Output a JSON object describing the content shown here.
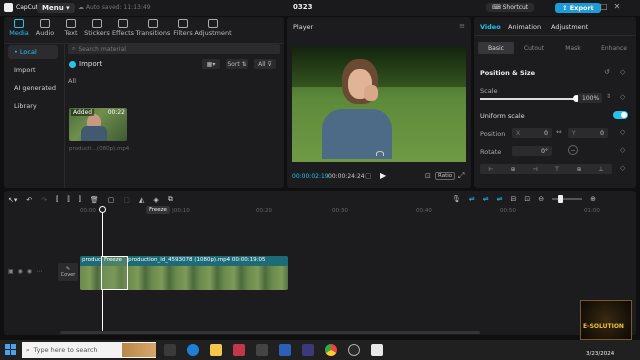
{
  "titlebar": {
    "app_name": "CapCut",
    "menu_label": "Menu",
    "autosave": "Auto saved: 11:13:49",
    "project_name": "0323",
    "shortcut_label": "Shortcut",
    "export_label": "Export"
  },
  "toolbar": {
    "tabs": [
      {
        "label": "Media",
        "icon": "media-icon"
      },
      {
        "label": "Audio",
        "icon": "audio-icon"
      },
      {
        "label": "Text",
        "icon": "text-icon"
      },
      {
        "label": "Stickers",
        "icon": "stickers-icon"
      },
      {
        "label": "Effects",
        "icon": "effects-icon"
      },
      {
        "label": "Transitions",
        "icon": "transitions-icon"
      },
      {
        "label": "Filters",
        "icon": "filters-icon"
      },
      {
        "label": "Adjustment",
        "icon": "adjustment-icon"
      }
    ]
  },
  "media": {
    "sidebar": [
      "• Local",
      "Import",
      "AI generated",
      "Library"
    ],
    "search_placeholder": "Search material",
    "import_label": "Import",
    "sort_label": "Sort",
    "all_label": "All",
    "filter_all": "All",
    "clip": {
      "badge": "Added",
      "duration": "00:22",
      "name": "producti...(080p).mp4"
    }
  },
  "player": {
    "title": "Player",
    "current_time": "00:00:02:19",
    "total_time": "00:00:24:24",
    "ratio_label": "Ratio"
  },
  "props": {
    "tabs": [
      "Video",
      "Animation",
      "Adjustment"
    ],
    "subtabs": [
      "Basic",
      "Cutout",
      "Mask",
      "Enhance"
    ],
    "section_title": "Position & Size",
    "scale_label": "Scale",
    "scale_value": "100%",
    "scale_level": 1.0,
    "uniform_label": "Uniform scale",
    "position_label": "Position",
    "pos_x_label": "X",
    "pos_x": "0",
    "pos_y_label": "Y",
    "pos_y": "0",
    "rotate_label": "Rotate",
    "rotate_value": "0°"
  },
  "timeline": {
    "tooltip": "Freeze",
    "ruler": [
      "00:00",
      "|00:10",
      "00:20",
      "00:30",
      "00:40",
      "00:50",
      "01:00"
    ],
    "cover_label": "Cover",
    "clip_short": "produc",
    "freeze_label": "Freeze",
    "clip_title": "production_id_4593078 (1080p).mp4  00:00:19:05"
  },
  "taskbar": {
    "search_placeholder": "Type here to search",
    "time": "3/23/2024",
    "watermark": "E-SOLUTION"
  },
  "colors": {
    "accent": "#27c2ef",
    "export": "#1c9bd6",
    "clip_bg": "#1e6b78"
  }
}
